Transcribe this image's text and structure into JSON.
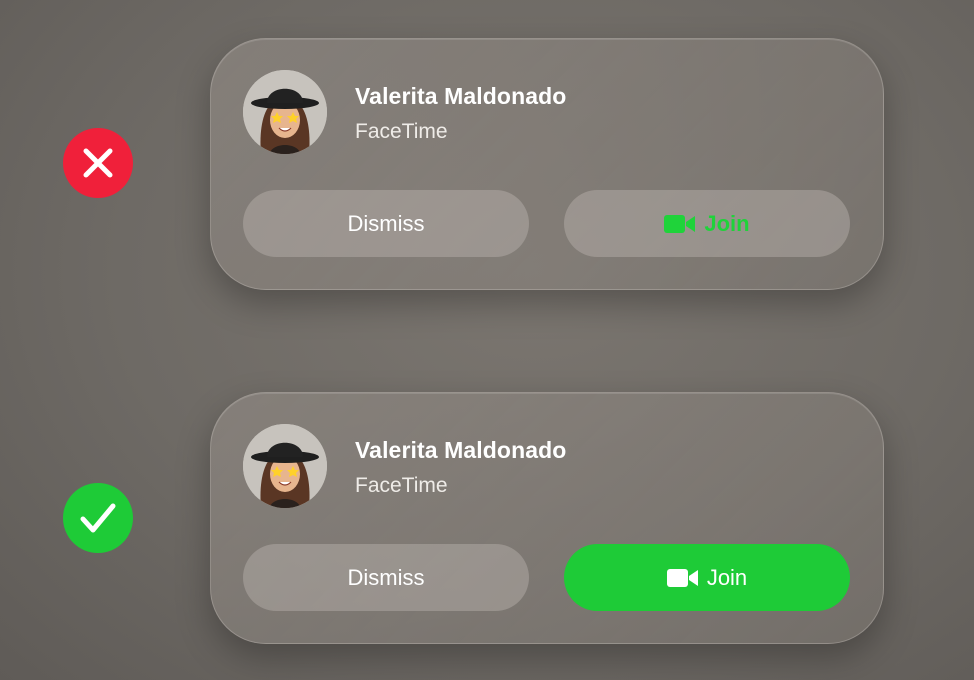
{
  "examples": [
    {
      "verdict_icon": "x-icon",
      "verdict_color": "#f0203a",
      "caller_name": "Valerita Maldonado",
      "app_name": "FaceTime",
      "dismiss_label": "Dismiss",
      "join_label": "Join",
      "join_text_color": "#1fd33a"
    },
    {
      "verdict_icon": "checkmark-icon",
      "verdict_color": "#1ecb37",
      "caller_name": "Valerita Maldonado",
      "app_name": "FaceTime",
      "dismiss_label": "Dismiss",
      "join_label": "Join",
      "join_background_color": "#1ecb37"
    }
  ]
}
